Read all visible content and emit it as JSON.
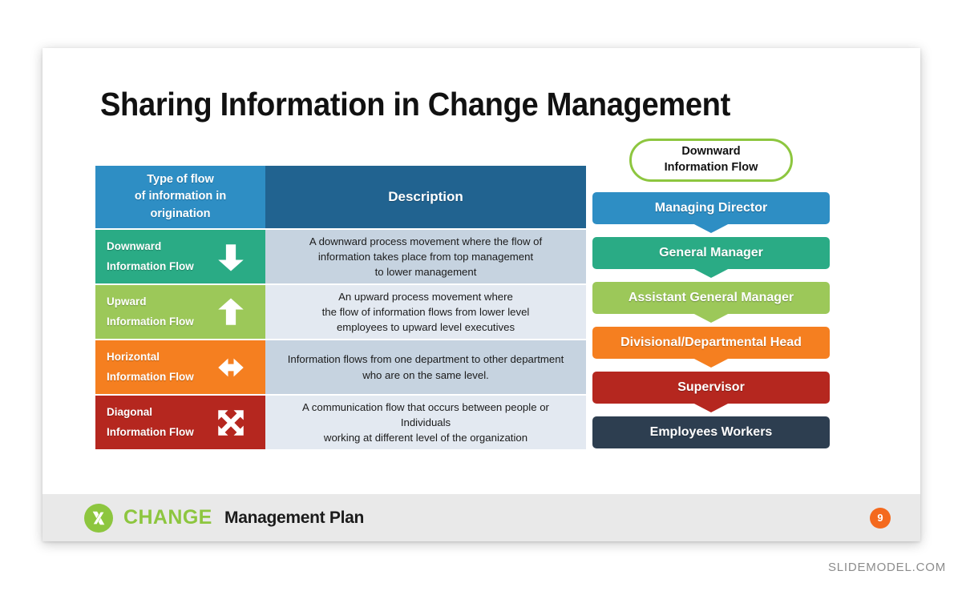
{
  "slide": {
    "title": "Sharing Information in Change Management"
  },
  "table": {
    "header": {
      "left_line1": "Type of flow",
      "left_line2": "of information  in",
      "left_line3": "origination",
      "right": "Description"
    },
    "rows": [
      {
        "label_line1": "Downward",
        "label_line2": "Information Flow",
        "icon": "arrow-down-icon",
        "color": "#2aab85",
        "desc_bg": "#c6d3e0",
        "description_lines": [
          "A downward process movement where the flow of",
          "information takes place from top management",
          "to lower management"
        ]
      },
      {
        "label_line1": "Upward",
        "label_line2": "Information Flow",
        "icon": "arrow-up-icon",
        "color": "#9cc859",
        "desc_bg": "#e3e9f1",
        "description_lines": [
          "An upward process movement where",
          "the flow of information flows from lower level",
          "employees to upward level executives"
        ]
      },
      {
        "label_line1": "Horizontal",
        "label_line2": "Information Flow",
        "icon": "arrow-left-right-icon",
        "color": "#f57f20",
        "desc_bg": "#c6d3e0",
        "description_lines": [
          "Information flows from one department to other department",
          "who are on the same level."
        ]
      },
      {
        "label_line1": "Diagonal",
        "label_line2": "Information Flow",
        "icon": "arrow-diagonal-x-icon",
        "color": "#b5271f",
        "desc_bg": "#e3e9f1",
        "description_lines": [
          "A communication flow that occurs between people or",
          "Individuals",
          "working at different level of the organization"
        ]
      }
    ]
  },
  "hierarchy": {
    "pill_line1": "Downward",
    "pill_line2": "Information Flow",
    "pill_border_color": "#8dc63f",
    "levels": [
      {
        "label": "Managing Director",
        "color": "#2e8ec4",
        "has_point": true
      },
      {
        "label": "General Manager",
        "color": "#2aab85",
        "has_point": true
      },
      {
        "label": "Assistant General Manager",
        "color": "#9cc859",
        "has_point": true
      },
      {
        "label": "Divisional/Departmental Head",
        "color": "#f57f20",
        "has_point": true
      },
      {
        "label": "Supervisor",
        "color": "#b5271f",
        "has_point": true
      },
      {
        "label": "Employees Workers",
        "color": "#2d3e50",
        "has_point": false
      }
    ]
  },
  "footer": {
    "brand_name": "CHANGE",
    "brand_subtitle": "Management Plan",
    "brand_color": "#8dc63f",
    "page_number": "9",
    "page_badge_color": "#f4691d"
  },
  "watermark": {
    "text": "SLIDEMODEL.COM"
  }
}
